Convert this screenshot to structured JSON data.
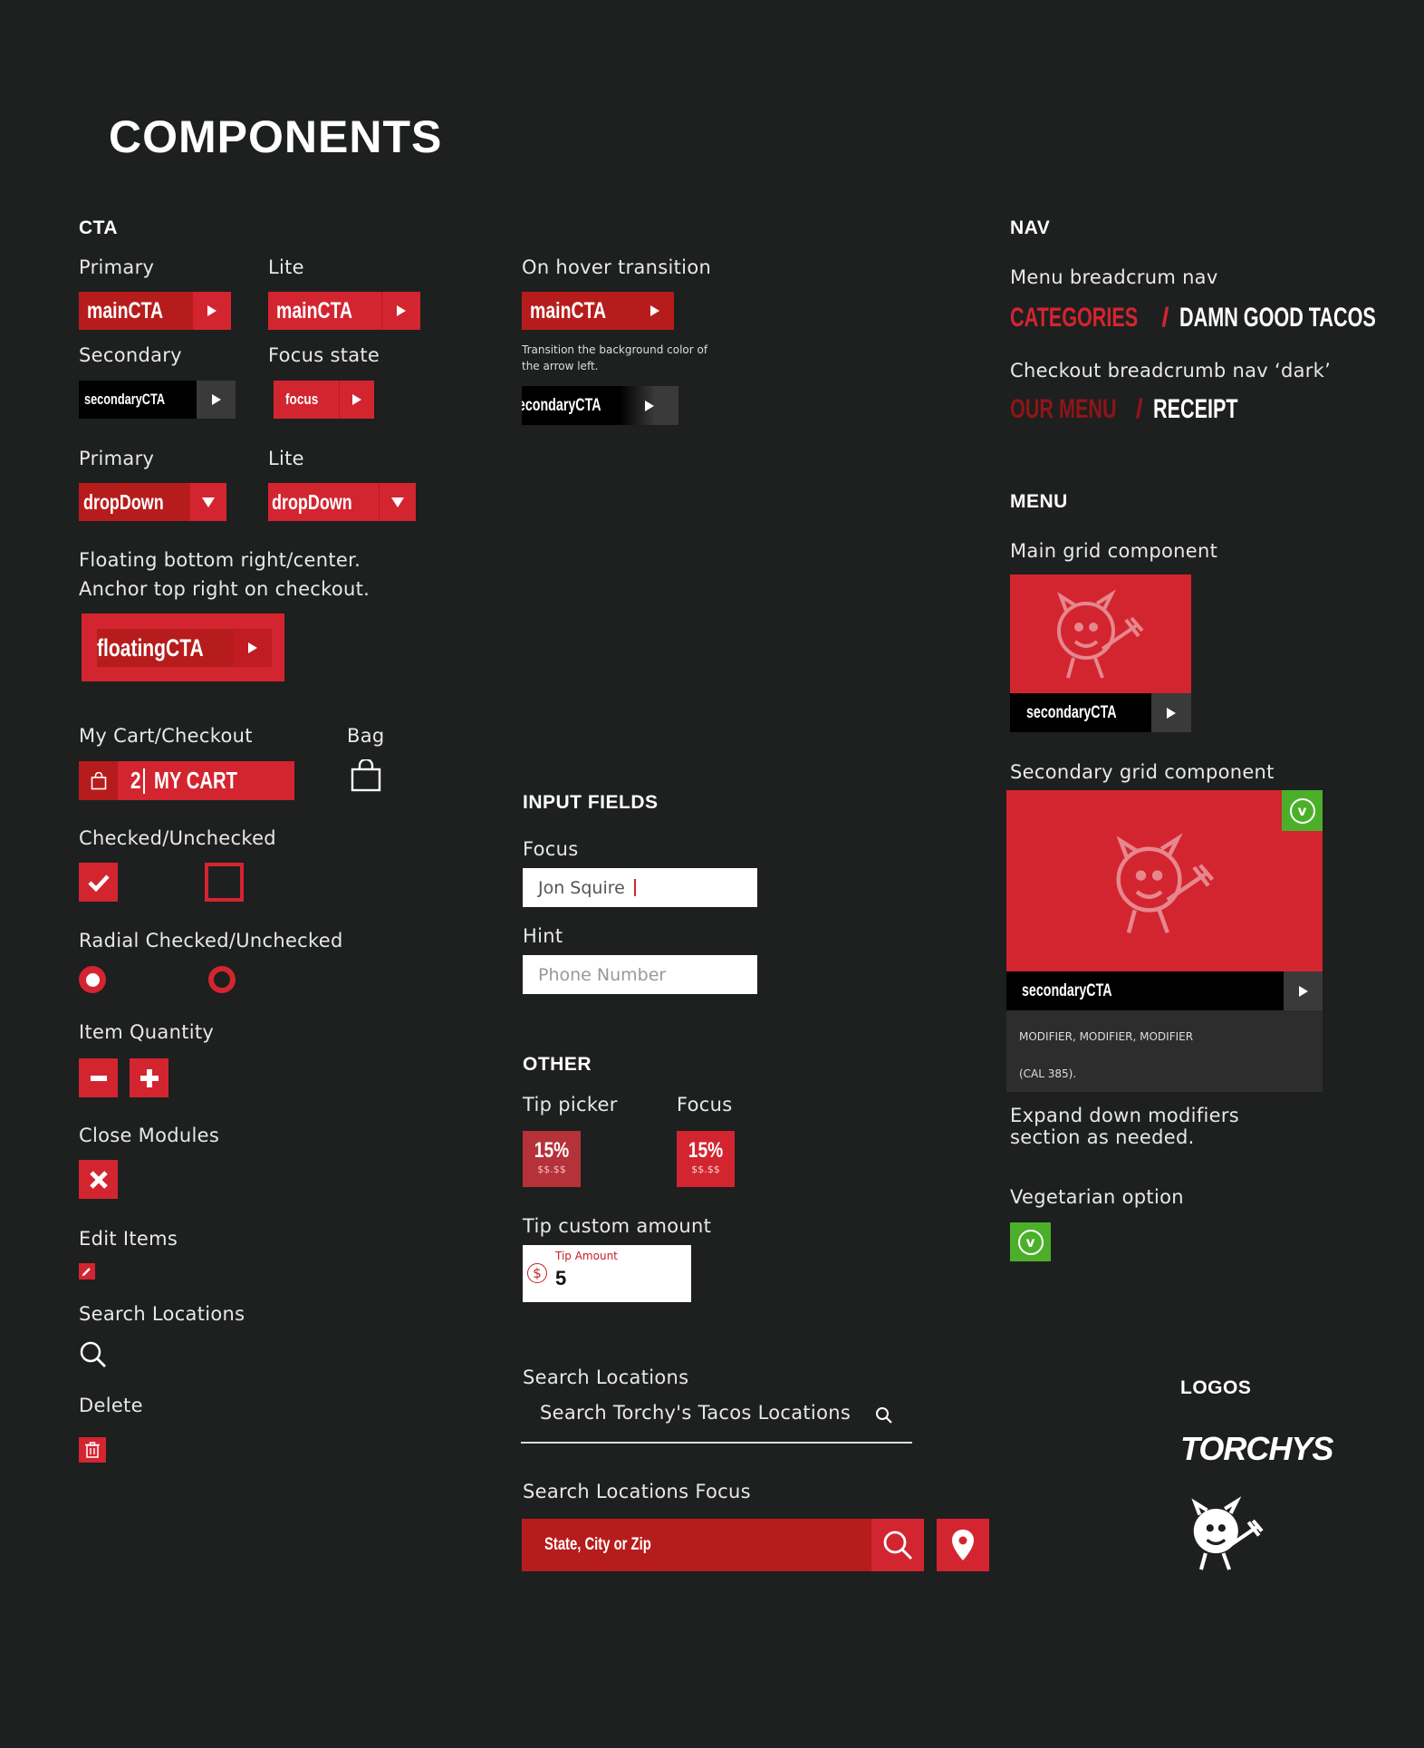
{
  "page": {
    "title": "COMPONENTS"
  },
  "colors": {
    "background": "#1e1f1f",
    "primary_red": "#b71c1c",
    "lite_red": "#d32530",
    "green": "#4caf2a"
  },
  "cta": {
    "heading": "CTA",
    "primary_label": "Primary",
    "lite_label": "Lite",
    "main_cta": "mainCTA",
    "secondary_label": "Secondary",
    "focus_state_label": "Focus state",
    "secondary_cta": "secondaryCTA",
    "focus_cta": "focus",
    "primary2_label": "Primary",
    "lite2_label": "Lite",
    "dropdown": "dropDown",
    "floating_line1": "Floating bottom right/center.",
    "floating_line2": "Anchor top right on checkout.",
    "floating_cta": "floatingCTA"
  },
  "hover": {
    "label": "On hover transition",
    "main_cta": "mainCTA",
    "note_line1": "Transition the background color of",
    "note_line2": "the arrow left.",
    "secondary_cta": "secondaryCTA"
  },
  "cart": {
    "label": "My Cart/Checkout",
    "count": "2",
    "text": "MY CART",
    "bag_label": "Bag"
  },
  "checks": {
    "label": "Checked/Unchecked",
    "radial_label": "Radial Checked/Unchecked"
  },
  "quantity": {
    "label": "Item Quantity"
  },
  "close": {
    "label": "Close Modules"
  },
  "edit": {
    "label": "Edit Items"
  },
  "search_left": {
    "label": "Search Locations"
  },
  "delete": {
    "label": "Delete"
  },
  "inputs": {
    "heading": "INPUT FIELDS",
    "focus_label": "Focus",
    "focus_value": "Jon Squire",
    "hint_label": "Hint",
    "hint_placeholder": "Phone Number"
  },
  "other": {
    "heading": "OTHER",
    "tip_picker_label": "Tip picker",
    "focus_label": "Focus",
    "tip_percent": "15%",
    "tip_amount": "$$.$$",
    "tip_percent_focus": "15%",
    "tip_amount_focus": "$$.$$",
    "custom_label": "Tip custom amount",
    "custom_field_label": "Tip Amount",
    "custom_value": "5",
    "currency_symbol": "$"
  },
  "search": {
    "label": "Search Locations",
    "placeholder": "Search Torchy's Tacos Locations",
    "focus_label": "Search Locations Focus",
    "focus_placeholder": "State, City or Zip"
  },
  "nav": {
    "heading": "NAV",
    "breadcrumb_label": "Menu breadcrum nav",
    "crumb1": "CATEGORIES",
    "crumb2": "DAMN GOOD TACOS",
    "checkout_label": "Checkout breadcrumb nav ‘dark’",
    "crumb3": "OUR MENU",
    "crumb4": "RECEIPT",
    "separator": "/"
  },
  "menu": {
    "heading": "MENU",
    "main_grid_label": "Main grid component",
    "main_grid_cta": "secondaryCTA",
    "secondary_grid_label": "Secondary grid component",
    "secondary_grid_cta": "secondaryCTA",
    "veg_badge": "v",
    "modifiers": "MODIFIER, MODIFIER, MODIFIER",
    "calories": "(CAL 385).",
    "expand_line1": "Expand down modifiers",
    "expand_line2": "section as needed.",
    "veg_label": "Vegetarian option",
    "veg_badge2": "v"
  },
  "logos": {
    "heading": "LOGOS",
    "wordmark": "TORCHYS"
  }
}
